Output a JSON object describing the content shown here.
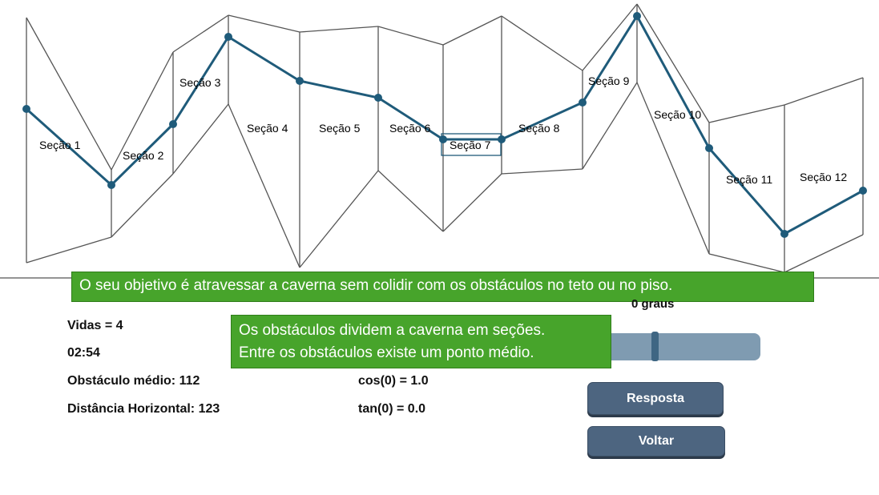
{
  "sections": [
    {
      "label": "Seção 1"
    },
    {
      "label": "Seção 2"
    },
    {
      "label": "Seção 3"
    },
    {
      "label": "Seção 4"
    },
    {
      "label": "Seção 5"
    },
    {
      "label": "Seção 6"
    },
    {
      "label": "Seção 7"
    },
    {
      "label": "Seção 8"
    },
    {
      "label": "Seção 9"
    },
    {
      "label": "Seção 10"
    },
    {
      "label": "Seção 11"
    },
    {
      "label": "Seção 12"
    }
  ],
  "current_section": 7,
  "hud": {
    "lives": "Vidas = 4",
    "timer": "02:54",
    "avg_obstacle": "Obstáculo médio: 112",
    "horizontal_distance": "Distância Horizontal: 123",
    "cos": "cos(0) = 1.0",
    "tan": "tan(0) = 0.0",
    "angle": "0 graus"
  },
  "slider": {
    "value": 0.36
  },
  "buttons": {
    "answer": "Resposta",
    "back": "Voltar"
  },
  "tips": {
    "objective": "O seu objetivo é atravessar a caverna sem colidir com os obstáculos no teto ou no piso.",
    "sections_line1": "Os obstáculos dividem a caverna em seções.",
    "sections_line2": "Entre os obstáculos existe um ponto médio."
  },
  "colors": {
    "path": "#1f5b7a",
    "walls": "#555555",
    "tip_bg": "#47a42b",
    "button": "#4d6580",
    "slider_track": "#7f9bb1"
  }
}
